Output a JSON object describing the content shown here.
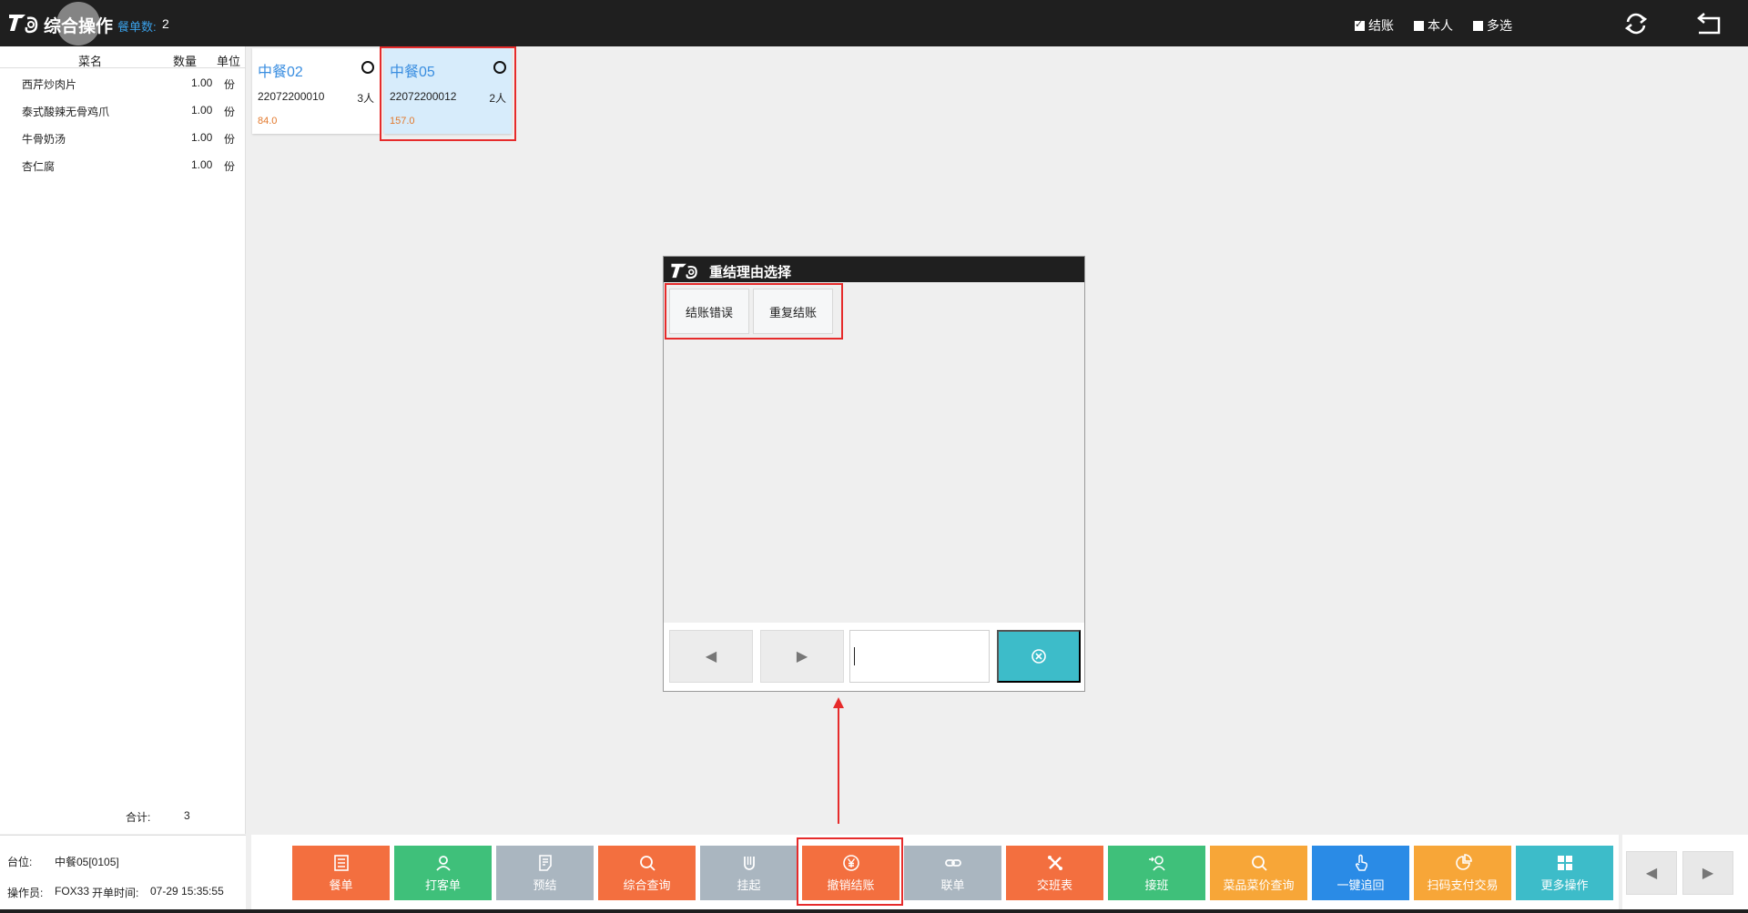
{
  "header": {
    "title": "综合操作",
    "order_count_label": "餐单数:",
    "order_count": "2",
    "filters": [
      {
        "label": "结账",
        "checked": true
      },
      {
        "label": "本人",
        "checked": false
      },
      {
        "label": "多选",
        "checked": false
      }
    ],
    "refresh_icon": "refresh-icon",
    "back_icon": "return-icon"
  },
  "dish_list": {
    "headers": [
      "菜名",
      "数量",
      "单位"
    ],
    "rows": [
      {
        "name": "西芹炒肉片",
        "qty": "1.00",
        "unit": "份"
      },
      {
        "name": "泰式酸辣无骨鸡爪",
        "qty": "1.00",
        "unit": "份"
      },
      {
        "name": "牛骨奶汤",
        "qty": "1.00",
        "unit": "份"
      },
      {
        "name": "杏仁腐",
        "qty": "1.00",
        "unit": "份"
      }
    ],
    "total_label": "合计:",
    "total_value": "3"
  },
  "info": {
    "table_label": "台位:",
    "table_value": "中餐05[0105]",
    "operator_label": "操作员:",
    "operator_value": "FOX33",
    "open_time_label": "开单时间:",
    "open_time_value": "07-29 15:35:55"
  },
  "tables": [
    {
      "name": "中餐02",
      "code": "22072200010",
      "people": "3人",
      "amount": "84.0",
      "selected": false
    },
    {
      "name": "中餐05",
      "code": "22072200012",
      "people": "2人",
      "amount": "157.0",
      "selected": true
    }
  ],
  "dialog": {
    "title": "重结理由选择",
    "reasons": [
      "结账错误",
      "重复结账"
    ],
    "prev_icon": "triangle-left-icon",
    "next_icon": "triangle-right-icon",
    "input_value": "",
    "clear_icon": "circle-x-icon"
  },
  "toolbar": {
    "buttons": [
      {
        "label": "餐单",
        "color": "#f36f3f",
        "icon": "list-icon",
        "enabled": true
      },
      {
        "label": "打客单",
        "color": "#3fc07a",
        "icon": "user-print-icon",
        "enabled": true
      },
      {
        "label": "预结",
        "color": "#aab6c0",
        "icon": "document-icon",
        "enabled": false
      },
      {
        "label": "综合查询",
        "color": "#f36f3f",
        "icon": "search-icon",
        "enabled": true
      },
      {
        "label": "挂起",
        "color": "#aab6c0",
        "icon": "hold-icon",
        "enabled": false
      },
      {
        "label": "撤销结账",
        "color": "#f36f3f",
        "icon": "yen-icon",
        "enabled": true
      },
      {
        "label": "联单",
        "color": "#aab6c0",
        "icon": "link-icon",
        "enabled": false
      },
      {
        "label": "交班表",
        "color": "#f36f3f",
        "icon": "tools-icon",
        "enabled": true
      },
      {
        "label": "接班",
        "color": "#3fc07a",
        "icon": "user-arrow-icon",
        "enabled": true
      },
      {
        "label": "菜品菜价查询",
        "color": "#f7a638",
        "icon": "search-icon",
        "enabled": true
      },
      {
        "label": "一键追回",
        "color": "#2a8be6",
        "icon": "hand-tap-icon",
        "enabled": true
      },
      {
        "label": "扫码支付交易",
        "color": "#f7a638",
        "icon": "pie-chart-icon",
        "enabled": true
      },
      {
        "label": "更多操作",
        "color": "#3dbcc9",
        "icon": "grid-icon",
        "enabled": true
      }
    ],
    "prev_icon": "triangle-left-icon",
    "next_icon": "triangle-right-icon"
  },
  "colors": {
    "topbar": "#1f1f1f",
    "accent_blue": "#3a8ee0",
    "amount_orange": "#e2792c",
    "highlight_red": "#e62b2b"
  }
}
